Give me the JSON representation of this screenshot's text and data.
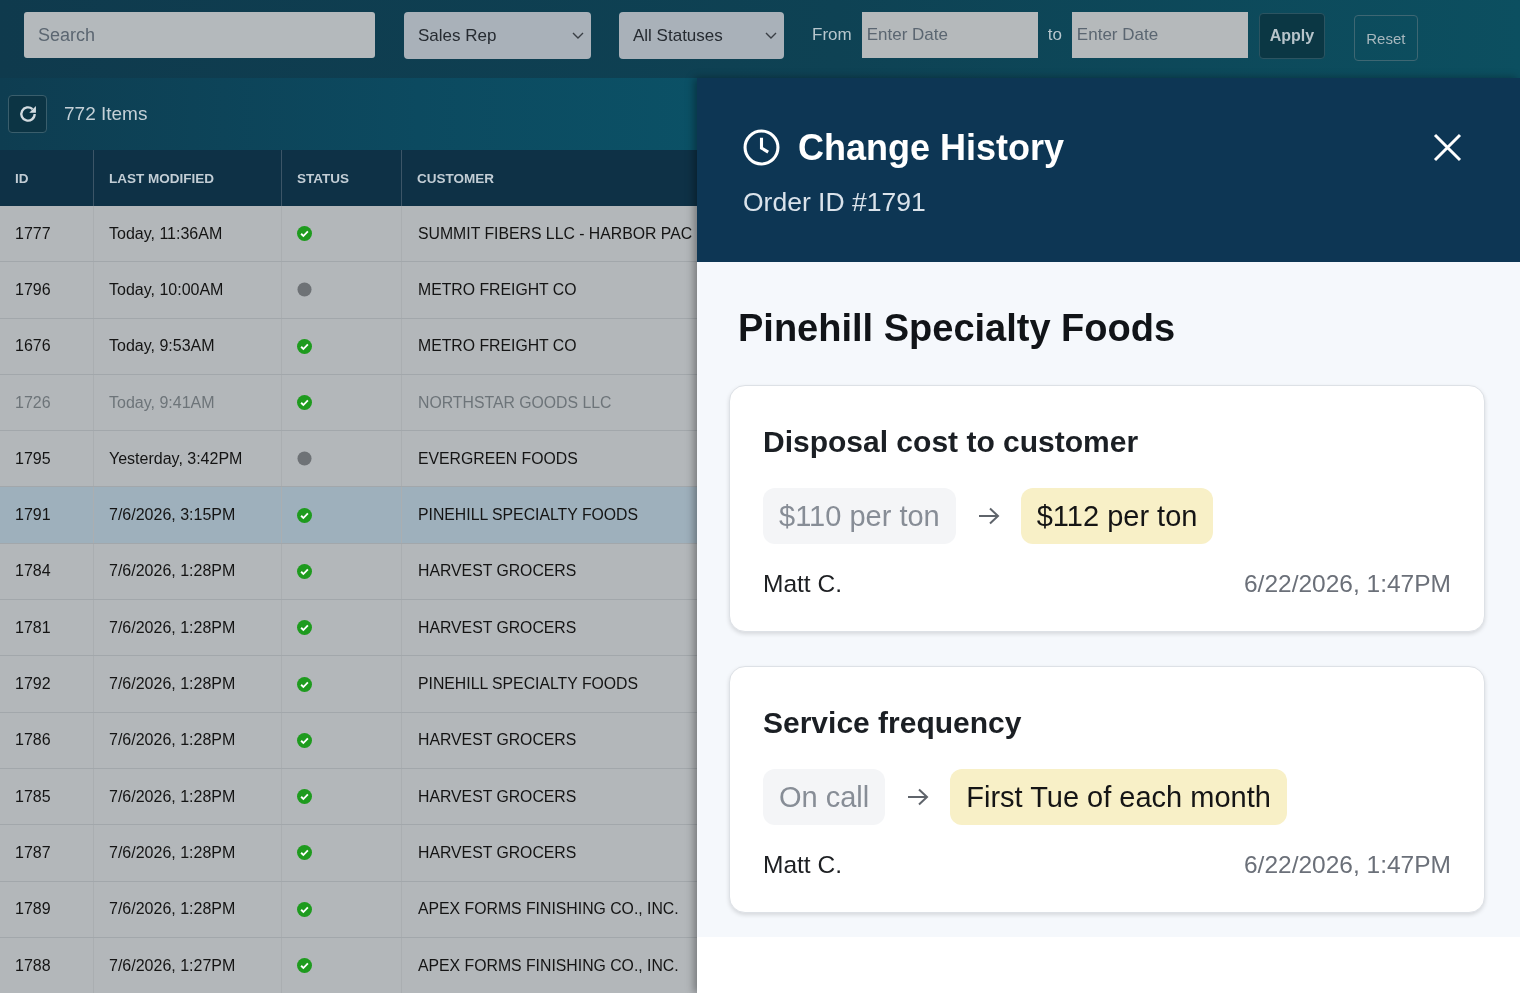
{
  "filters": {
    "search": {
      "placeholder": "Search"
    },
    "sales_rep": {
      "value": "Sales Rep"
    },
    "status": {
      "value": "All Statuses"
    },
    "date_from": {
      "label": "From",
      "placeholder": "Enter Date"
    },
    "date_to": {
      "label": "to",
      "placeholder": "Enter Date"
    },
    "buttons": [
      {
        "label": "Apply",
        "kind": "primary"
      },
      {
        "label": "Reset",
        "kind": "secondary"
      }
    ]
  },
  "toolbar": {
    "item_count": "772 Items"
  },
  "table": {
    "columns": [
      "ID",
      "LAST MODIFIED",
      "STATUS",
      "CUSTOMER"
    ],
    "rows": [
      {
        "id": "1777",
        "last_modified": "Today, 11:36AM",
        "complete": true,
        "customer": "SUMMIT FIBERS LLC - HARBOR PAC",
        "selected": false,
        "disabled": false
      },
      {
        "id": "1796",
        "last_modified": "Today, 10:00AM",
        "complete": false,
        "customer": "METRO FREIGHT CO",
        "selected": false,
        "disabled": false
      },
      {
        "id": "1676",
        "last_modified": "Today, 9:53AM",
        "complete": true,
        "customer": "METRO FREIGHT CO",
        "selected": false,
        "disabled": false
      },
      {
        "id": "1726",
        "last_modified": "Today, 9:41AM",
        "complete": true,
        "customer": "NORTHSTAR GOODS LLC",
        "selected": false,
        "disabled": true
      },
      {
        "id": "1795",
        "last_modified": "Yesterday, 3:42PM",
        "complete": false,
        "customer": "EVERGREEN FOODS",
        "selected": false,
        "disabled": false
      },
      {
        "id": "1791",
        "last_modified": "7/6/2026, 3:15PM",
        "complete": true,
        "customer": "PINEHILL SPECIALTY FOODS",
        "selected": true,
        "disabled": false
      },
      {
        "id": "1784",
        "last_modified": "7/6/2026, 1:28PM",
        "complete": true,
        "customer": "HARVEST GROCERS",
        "selected": false,
        "disabled": false
      },
      {
        "id": "1781",
        "last_modified": "7/6/2026, 1:28PM",
        "complete": true,
        "customer": "HARVEST GROCERS",
        "selected": false,
        "disabled": false
      },
      {
        "id": "1792",
        "last_modified": "7/6/2026, 1:28PM",
        "complete": true,
        "customer": "PINEHILL SPECIALTY FOODS",
        "selected": false,
        "disabled": false
      },
      {
        "id": "1786",
        "last_modified": "7/6/2026, 1:28PM",
        "complete": true,
        "customer": "HARVEST GROCERS",
        "selected": false,
        "disabled": false
      },
      {
        "id": "1785",
        "last_modified": "7/6/2026, 1:28PM",
        "complete": true,
        "customer": "HARVEST GROCERS",
        "selected": false,
        "disabled": false
      },
      {
        "id": "1787",
        "last_modified": "7/6/2026, 1:28PM",
        "complete": true,
        "customer": "HARVEST GROCERS",
        "selected": false,
        "disabled": false
      },
      {
        "id": "1789",
        "last_modified": "7/6/2026, 1:28PM",
        "complete": true,
        "customer": "APEX FORMS FINISHING CO., INC.",
        "selected": false,
        "disabled": false
      },
      {
        "id": "1788",
        "last_modified": "7/6/2026, 1:27PM",
        "complete": true,
        "customer": "APEX FORMS FINISHING CO., INC.",
        "selected": false,
        "disabled": false
      }
    ]
  },
  "change_history": {
    "title": "Change History",
    "subtitle": "Order ID #1791",
    "customer": "Pinehill Specialty Foods",
    "changes": [
      {
        "field": "Disposal cost to customer",
        "old_value": "$110 per ton",
        "new_value": "$112 per ton",
        "author": "Matt C.",
        "time": "6/22/2026, 1:47PM"
      },
      {
        "field": "Service frequency",
        "old_value": "On call",
        "new_value": "First Tue of each month",
        "author": "Matt C.",
        "time": "6/22/2026, 1:47PM"
      }
    ]
  }
}
